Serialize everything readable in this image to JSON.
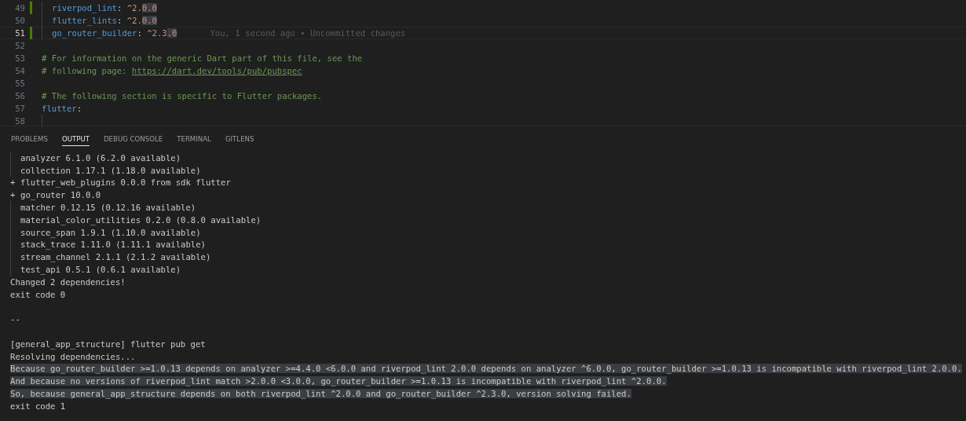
{
  "editor": {
    "lines": [
      {
        "number": "49",
        "current": false,
        "git_modified": true,
        "indented": true,
        "tokens": [
          {
            "kind": "key",
            "text": "riverpod_lint"
          },
          {
            "kind": "punct",
            "text": ": "
          },
          {
            "kind": "number",
            "text": "^2."
          },
          {
            "kind": "match",
            "text": "0.0"
          }
        ]
      },
      {
        "number": "50",
        "current": false,
        "git_modified": false,
        "indented": true,
        "tokens": [
          {
            "kind": "key",
            "text": "flutter_lints"
          },
          {
            "kind": "punct",
            "text": ": "
          },
          {
            "kind": "number",
            "text": "^2."
          },
          {
            "kind": "match",
            "text": "0.0"
          }
        ]
      },
      {
        "number": "51",
        "current": true,
        "git_modified": true,
        "indented": true,
        "blame": "You, 1 second ago • Uncommitted changes",
        "tokens": [
          {
            "kind": "key",
            "text": "go_router_builder"
          },
          {
            "kind": "punct",
            "text": ": "
          },
          {
            "kind": "number",
            "text": "^2.3"
          },
          {
            "kind": "match",
            "text": ".0"
          }
        ]
      },
      {
        "number": "52",
        "current": false,
        "git_modified": false,
        "indented": false
      },
      {
        "number": "53",
        "current": false,
        "git_modified": false,
        "indented": false,
        "tokens": [
          {
            "kind": "comment",
            "text": "# For information on the generic Dart part of this file, see the"
          }
        ]
      },
      {
        "number": "54",
        "current": false,
        "git_modified": false,
        "indented": false,
        "tokens": [
          {
            "kind": "comment",
            "text": "# following page: "
          },
          {
            "kind": "link",
            "text": "https://dart.dev/tools/pub/pubspec"
          }
        ]
      },
      {
        "number": "55",
        "current": false,
        "git_modified": false,
        "indented": false
      },
      {
        "number": "56",
        "current": false,
        "git_modified": false,
        "indented": false,
        "tokens": [
          {
            "kind": "comment",
            "text": "# The following section is specific to Flutter packages."
          }
        ]
      },
      {
        "number": "57",
        "current": false,
        "git_modified": false,
        "indented": false,
        "tokens": [
          {
            "kind": "key",
            "text": "flutter"
          },
          {
            "kind": "punct",
            "text": ":"
          }
        ]
      },
      {
        "number": "58",
        "current": false,
        "git_modified": false,
        "indented": true
      }
    ]
  },
  "panel": {
    "tabs": [
      {
        "label": "PROBLEMS",
        "selected": false
      },
      {
        "label": "OUTPUT",
        "selected": true
      },
      {
        "label": "DEBUG CONSOLE",
        "selected": false
      },
      {
        "label": "TERMINAL",
        "selected": false
      },
      {
        "label": "GITLENS",
        "selected": false
      }
    ],
    "output": [
      {
        "kind": "indented",
        "text": "analyzer 6.1.0 (6.2.0 available)",
        "highlighted": false
      },
      {
        "kind": "indented",
        "text": "collection 1.17.1 (1.18.0 available)",
        "highlighted": false
      },
      {
        "kind": "added",
        "prefix": "+",
        "text": "flutter_web_plugins 0.0.0 from sdk flutter",
        "highlighted": false
      },
      {
        "kind": "added",
        "prefix": "+",
        "text": "go_router 10.0.0",
        "highlighted": false
      },
      {
        "kind": "indented",
        "text": "matcher 0.12.15 (0.12.16 available)",
        "highlighted": false
      },
      {
        "kind": "indented",
        "text": "material_color_utilities 0.2.0 (0.8.0 available)",
        "highlighted": false
      },
      {
        "kind": "indented",
        "text": "source_span 1.9.1 (1.10.0 available)",
        "highlighted": false
      },
      {
        "kind": "indented",
        "text": "stack_trace 1.11.0 (1.11.1 available)",
        "highlighted": false
      },
      {
        "kind": "indented",
        "text": "stream_channel 2.1.1 (2.1.2 available)",
        "highlighted": false
      },
      {
        "kind": "indented",
        "text": "test_api 0.5.1 (0.6.1 available)",
        "highlighted": false
      },
      {
        "kind": "plain",
        "text": "Changed 2 dependencies!",
        "highlighted": false
      },
      {
        "kind": "plain",
        "text": "exit code 0",
        "highlighted": false
      },
      {
        "kind": "blank"
      },
      {
        "kind": "plain",
        "text": "--",
        "highlighted": false
      },
      {
        "kind": "blank"
      },
      {
        "kind": "plain",
        "text": "[general_app_structure] flutter pub get",
        "highlighted": false
      },
      {
        "kind": "plain",
        "text": "Resolving dependencies...",
        "highlighted": false
      },
      {
        "kind": "plain",
        "text": "Because go_router_builder >=1.0.13 depends on analyzer >=4.4.0 <6.0.0 and riverpod_lint 2.0.0 depends on analyzer ^6.0.0, go_router_builder >=1.0.13 is incompatible with riverpod_lint 2.0.0.",
        "highlighted": true
      },
      {
        "kind": "plain",
        "text": "And because no versions of riverpod_lint match >2.0.0 <3.0.0, go_router_builder >=1.0.13 is incompatible with riverpod_lint ^2.0.0.",
        "highlighted": true
      },
      {
        "kind": "plain",
        "text": "So, because general_app_structure depends on both riverpod_lint ^2.0.0 and go_router_builder ^2.3.0, version solving failed.",
        "highlighted": true
      },
      {
        "kind": "plain",
        "text": "exit code 1",
        "highlighted": false
      }
    ]
  }
}
